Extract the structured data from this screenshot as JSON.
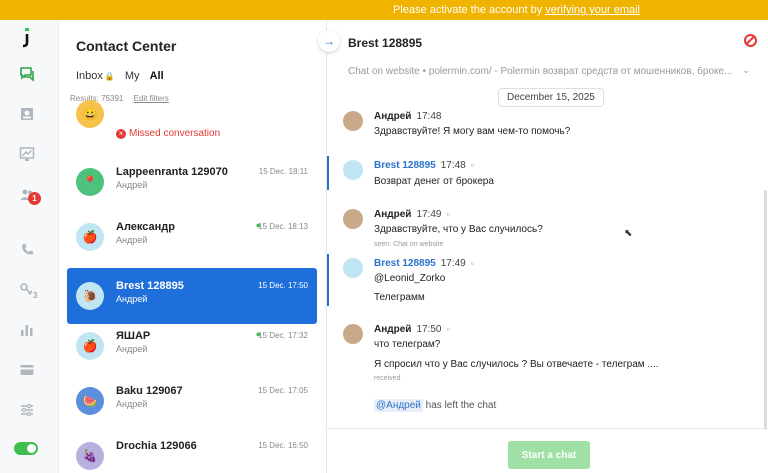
{
  "banner": {
    "text": "Please activate the account by",
    "link": "verifying your email"
  },
  "rail": {
    "badge": "1",
    "sub3": "3"
  },
  "list": {
    "title": "Contact Center",
    "tabs": [
      "Inbox",
      "My",
      "All"
    ],
    "results": "Results: 75391",
    "edit_filters": "Edit filters",
    "missed": "Missed conversation",
    "items": [
      {
        "name": "Lappeenranta 129070",
        "sub": "Андрей",
        "time": "15 Dec. 18:11",
        "color": "#4cc37a",
        "icon": "map-pin-icon"
      },
      {
        "name": "Александр",
        "sub": "Андрей",
        "time": "15 Dec. 18:13",
        "color": "#bfe6f2",
        "icon": "apple-icon"
      },
      {
        "name": "Brest 128895",
        "sub": "Андрей",
        "time": "15 Dec. 17:50",
        "color": "#bfe6f2",
        "icon": "snail-icon"
      },
      {
        "name": "ЯШАР",
        "sub": "Андрей",
        "time": "15 Dec. 17:32",
        "color": "#bfe6f2",
        "icon": "apple-icon"
      },
      {
        "name": "Baku 129067",
        "sub": "Андрей",
        "time": "15 Dec. 17:05",
        "color": "#5b8fdc",
        "icon": "watermelon-icon"
      },
      {
        "name": "Drochia 129066",
        "sub": "",
        "time": "15 Dec. 16:50",
        "color": "#b9b0e0",
        "icon": "grape-icon"
      }
    ]
  },
  "chat": {
    "title": "Brest 128895",
    "subheader": "Chat on website • polermin.com/ - Polermin возврат средств от мошенников, броке...",
    "date": "December 15, 2025",
    "messages": [
      {
        "author": "Андрей",
        "time": "17:48",
        "lines": [
          "Здравствуйте! Я могу вам чем-то помочь?"
        ],
        "meta": ""
      },
      {
        "author": "Brest 128895",
        "time": "17:48",
        "lines": [
          "Возврат денег от брокера"
        ],
        "meta": ""
      },
      {
        "author": "Андрей",
        "time": "17:49",
        "lines": [
          "Здравствуйте, что у Вас случилось?"
        ],
        "meta": "seen: Chat on website"
      },
      {
        "author": "Brest 128895",
        "time": "17:49",
        "lines": [
          "@Leonid_Zorko",
          "Телеграмм"
        ],
        "meta": ""
      },
      {
        "author": "Андрей",
        "time": "17:50",
        "lines": [
          "что телеграм?",
          "Я спросил что у Вас случилось ? Вы отвечаете - телеграм ...."
        ],
        "meta": "received"
      }
    ],
    "left_user": "@Андрей",
    "left_text": "has left the chat",
    "start_button": "Start a chat"
  }
}
